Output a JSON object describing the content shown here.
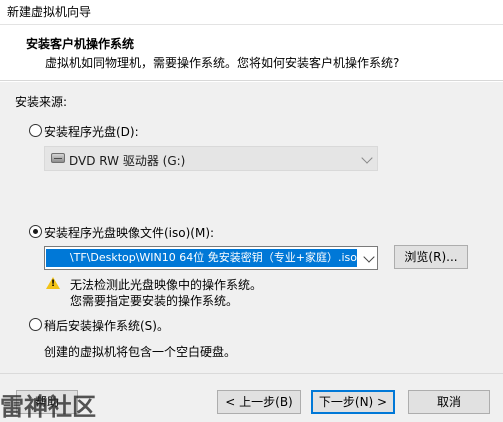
{
  "window": {
    "title": "新建虚拟机向导"
  },
  "header": {
    "title": "安装客户机操作系统",
    "subtitle": "虚拟机如同物理机，需要操作系统。您将如何安装客户机操作系统?"
  },
  "install_source": {
    "label": "安装来源:",
    "options": {
      "disc": {
        "label": "安装程序光盘(D):",
        "selected": false,
        "drive_value": "DVD RW 驱动器 (G:)",
        "enabled": false
      },
      "iso": {
        "label": "安装程序光盘映像文件(iso)(M):",
        "selected": true,
        "path_value": "\\TF\\Desktop\\WIN10 64位 免安装密钥（专业+家庭）.iso",
        "browse_label": "浏览(R)...",
        "warning_line1": "无法检测此光盘映像中的操作系统。",
        "warning_line2": "您需要指定要安装的操作系统。"
      },
      "later": {
        "label": "稍后安装操作系统(S)。",
        "selected": false,
        "description": "创建的虚拟机将包含一个空白硬盘。"
      }
    }
  },
  "footer": {
    "help_label": "帮助",
    "back_label": "< 上一步(B)",
    "next_label": "下一步(N) >",
    "cancel_label": "取消"
  },
  "watermark": "雷神社区",
  "colors": {
    "selection_blue": "#0078d7",
    "warning_yellow": "#f2c318",
    "dialog_bg": "#f0f0f0"
  },
  "icons": {
    "drive": "dvd-drive-icon",
    "warning": "warning-icon",
    "dropdown": "chevron-down-icon"
  }
}
